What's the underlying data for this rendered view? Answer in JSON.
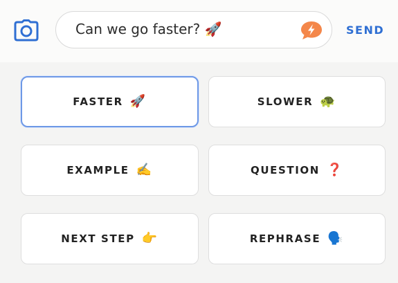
{
  "composer": {
    "camera_icon": "camera-icon",
    "input_value": "Can we go faster? 🚀",
    "boost_icon": "orange-speech-bubble-lightning-icon",
    "send_label": "SEND",
    "accent_color": "#2f6fd3",
    "boost_color": "#f4874a"
  },
  "quick_replies": [
    {
      "label": "FASTER",
      "emoji": "🚀",
      "selected": true
    },
    {
      "label": "SLOWER",
      "emoji": "🐢",
      "selected": false
    },
    {
      "label": "EXAMPLE",
      "emoji": "✍️",
      "selected": false
    },
    {
      "label": "QUESTION",
      "emoji": "❓",
      "selected": false
    },
    {
      "label": "NEXT STEP",
      "emoji": "👉",
      "selected": false
    },
    {
      "label": "REPHRASE",
      "emoji": "🗣️",
      "selected": false
    }
  ],
  "selected_border_color": "#6d98e6"
}
